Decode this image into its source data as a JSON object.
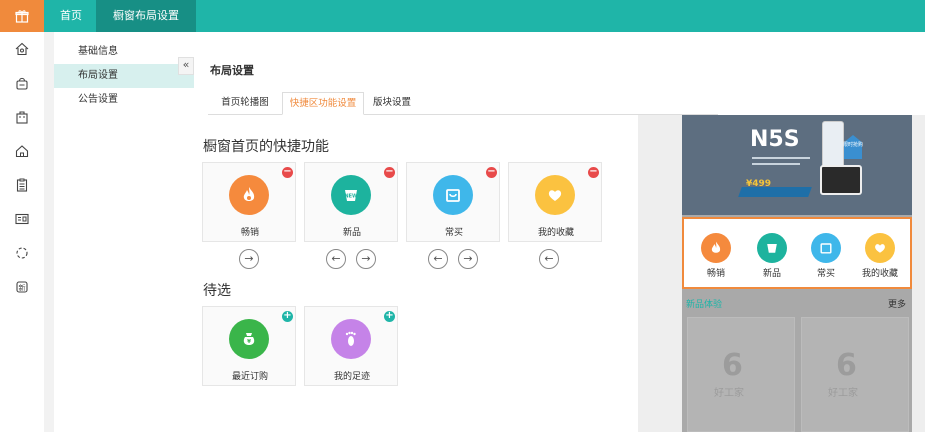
{
  "topbar": {
    "logo_icon": "gift-icon",
    "home_label": "首页",
    "active_label": "橱窗布局设置"
  },
  "iconbar": [
    "home-icon",
    "bag-icon",
    "shopping-bag-icon",
    "house-icon",
    "document-icon",
    "id-card-icon",
    "loading-icon",
    "news-icon"
  ],
  "menu": {
    "items": [
      {
        "label": "基础信息"
      },
      {
        "label": "布局设置"
      },
      {
        "label": "公告设置"
      }
    ],
    "collapse_glyph": "«"
  },
  "main": {
    "title": "布局设置",
    "tabs": [
      {
        "label": "首页轮播图"
      },
      {
        "label": "快捷区功能设置"
      },
      {
        "label": "版块设置"
      }
    ]
  },
  "quick": {
    "title": "橱窗首页的快捷功能",
    "cards": [
      {
        "label": "畅销",
        "color": "#f58a3d",
        "icon": "fire-icon"
      },
      {
        "label": "新品",
        "color": "#1db39e",
        "icon": "new-tag-icon"
      },
      {
        "label": "常买",
        "color": "#3fb7ea",
        "icon": "cart-icon"
      },
      {
        "label": "我的收藏",
        "color": "#fbc240",
        "icon": "heart-icon"
      }
    ]
  },
  "pending": {
    "title": "待选",
    "cards": [
      {
        "label": "最近订购",
        "color": "#3ab54a",
        "icon": "money-bag-icon"
      },
      {
        "label": "我的足迹",
        "color": "#c583e8",
        "icon": "footprint-icon"
      }
    ]
  },
  "preview": {
    "banner_title": "N5S",
    "banner_badge": "限时抢购",
    "banner_price": "¥499",
    "quick": [
      {
        "label": "畅销"
      },
      {
        "label": "新品"
      },
      {
        "label": "常买"
      },
      {
        "label": "我的收藏"
      }
    ],
    "new_title": "新品体验",
    "more_label": "更多",
    "product_logo": "6",
    "product_text": "好工家"
  }
}
